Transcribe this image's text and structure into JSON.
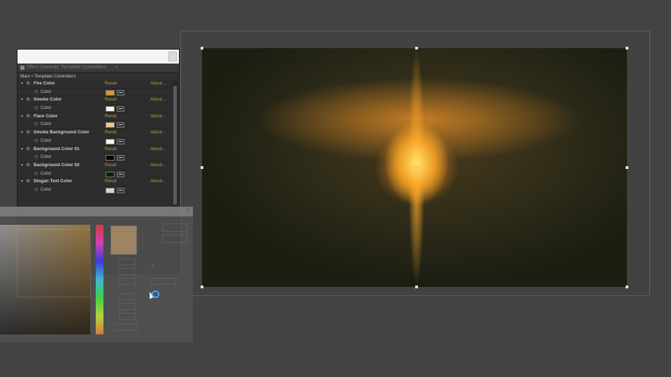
{
  "effect_controls": {
    "tab_label": "Effect Controls: Template Controllers",
    "breadcrumb": "Main • Template Controllers",
    "effects": [
      {
        "name": "Fire Color",
        "reset": "Reset",
        "about": "About...",
        "property": "Color",
        "swatch": "#d79a2a"
      },
      {
        "name": "Smoke Color",
        "reset": "Reset",
        "about": "About...",
        "property": "Color",
        "swatch": "#f2f2f2"
      },
      {
        "name": "Flare Color",
        "reset": "Reset",
        "about": "About...",
        "property": "Color",
        "swatch": "#f0c48e"
      },
      {
        "name": "Smoke Background Color",
        "reset": "Reset",
        "about": "About...",
        "property": "Color",
        "swatch": "#f4f4f4"
      },
      {
        "name": "Background Color 01",
        "reset": "Reset",
        "about": "About...",
        "property": "Color",
        "swatch": "#050505"
      },
      {
        "name": "Background Color 02",
        "reset": "Reset",
        "about": "About...",
        "property": "Color",
        "swatch": "#0d2016"
      },
      {
        "name": "Slogan Text Color",
        "reset": "Reset",
        "about": "About...",
        "property": "Color",
        "swatch": "#d6d6d6"
      }
    ]
  },
  "color_picker": {
    "close_label": "×",
    "preview_color": "#9e8462"
  },
  "icons": {
    "expand": "triangle-down-icon",
    "fx": "fx-icon",
    "stopwatch": "stopwatch-icon",
    "eyedropper": "eyedropper-icon",
    "anchor": "anchor-point-icon"
  }
}
